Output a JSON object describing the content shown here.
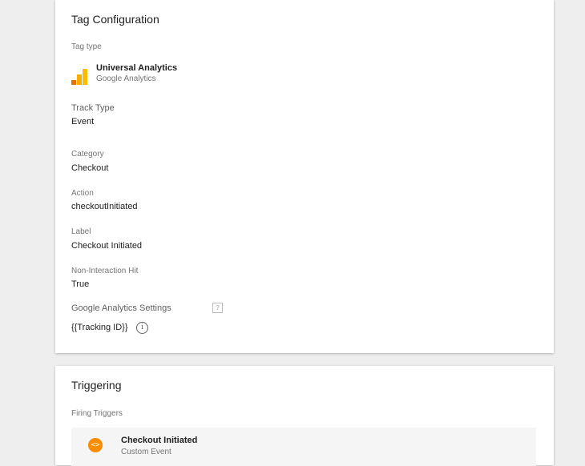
{
  "tag_config": {
    "title": "Tag Configuration",
    "tag_type_label": "Tag type",
    "tag_type_name": "Universal Analytics",
    "tag_type_sub": "Google Analytics",
    "track_type_label": "Track Type",
    "track_type_value": "Event",
    "category_label": "Category",
    "category_value": "Checkout",
    "action_label": "Action",
    "action_value": "checkoutInitiated",
    "label_label": "Label",
    "label_value": "Checkout Initiated",
    "noninteraction_label": "Non-Interaction Hit",
    "noninteraction_value": "True",
    "ga_settings_label": "Google Analytics Settings",
    "ga_settings_help": "?",
    "tracking_value": "{{Tracking ID}}",
    "info_glyph": "i",
    "icon": "google-analytics-icon"
  },
  "triggering": {
    "title": "Triggering",
    "firing_label": "Firing Triggers",
    "trigger_name": "Checkout Initiated",
    "trigger_type": "Custom Event",
    "trigger_glyph": "<>",
    "icon": "custom-event-icon",
    "accent_color": "#fb8c00"
  }
}
